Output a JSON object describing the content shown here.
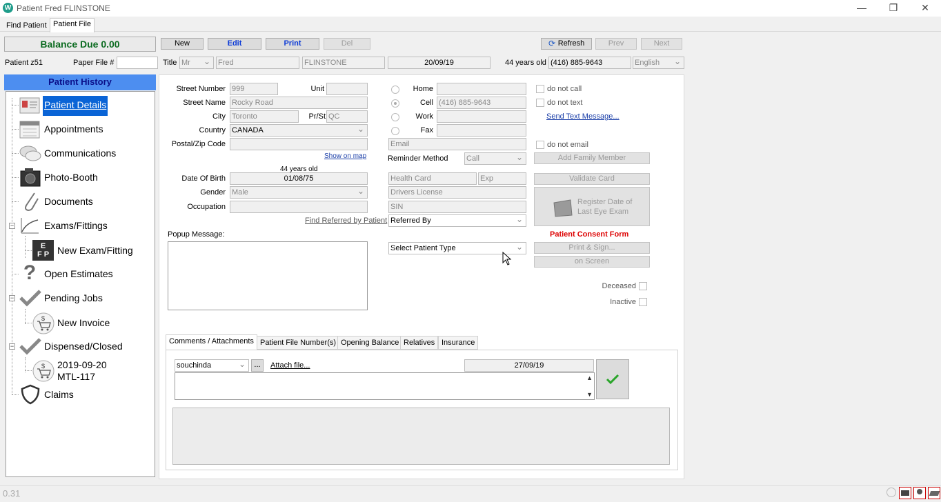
{
  "window": {
    "title": "Patient Fred FLINSTONE",
    "app_icon": "W",
    "min": "—",
    "max": "❐",
    "close": "✕"
  },
  "tabs": [
    "Find Patient",
    "Patient File"
  ],
  "toolbar": {
    "balance": "Balance Due 0.00",
    "new": "New",
    "edit": "Edit",
    "print": "Print",
    "del": "Del",
    "refresh": "Refresh",
    "prev": "Prev",
    "next": "Next"
  },
  "patient": {
    "id_label": "Patient z51",
    "paper_file_label": "Paper File #",
    "paper_file_value": "",
    "title_label": "Title",
    "title_value": "Mr",
    "first_name": "Fred",
    "last_name": "FLINSTONE",
    "date": "20/09/19",
    "age": "44 years old",
    "phone": "(416) 885-9643",
    "language": "English"
  },
  "sidebar": {
    "header": "Patient History",
    "items": [
      {
        "label": "Patient Details"
      },
      {
        "label": "Appointments"
      },
      {
        "label": "Communications"
      },
      {
        "label": "Photo-Booth"
      },
      {
        "label": "Documents"
      },
      {
        "label": "Exams/Fittings"
      },
      {
        "label": "New Exam/Fitting"
      },
      {
        "label": "Open Estimates"
      },
      {
        "label": "Pending Jobs"
      },
      {
        "label": "New Invoice"
      },
      {
        "label": "Dispensed/Closed"
      },
      {
        "label": "2019-09-20"
      },
      {
        "label": "MTL-117"
      },
      {
        "label": "Claims"
      }
    ]
  },
  "address": {
    "street_number_label": "Street Number",
    "street_number": "999",
    "unit_label": "Unit",
    "unit": "",
    "street_name_label": "Street Name",
    "street_name": "Rocky Road",
    "city_label": "City",
    "city": "Toronto",
    "prst_label": "Pr/St",
    "prst": "QC",
    "country_label": "Country",
    "country": "CANADA",
    "postal_label": "Postal/Zip Code",
    "postal": "",
    "show_on_map": "Show on map"
  },
  "personal": {
    "age_note": "44 years old",
    "dob_label": "Date Of Birth",
    "dob": "01/08/75",
    "gender_label": "Gender",
    "gender": "Male",
    "occupation_label": "Occupation",
    "occupation": "",
    "find_referred": "Find Referred by Patient",
    "popup_label": "Popup Message:"
  },
  "contact": {
    "home_label": "Home",
    "home": "",
    "cell_label": "Cell",
    "cell": "(416) 885-9643",
    "work_label": "Work",
    "work": "",
    "fax_label": "Fax",
    "fax": "",
    "email": "Email",
    "reminder_label": "Reminder Method",
    "reminder": "Call",
    "health_card": "Health Card",
    "exp": "Exp",
    "drivers_license": "Drivers License",
    "sin": "SIN",
    "referred_by": "Referred By",
    "patient_type": "Select Patient Type"
  },
  "options": {
    "do_not_call": "do not call",
    "do_not_text": "do not text",
    "send_text": "Send Text Message...",
    "do_not_email": "do not email",
    "add_family": "Add Family Member",
    "validate_card": "Validate Card",
    "register_eye_exam": "Register Date of Last Eye Exam",
    "consent_title": "Patient Consent Form",
    "print_sign": "Print & Sign...",
    "on_screen": "on Screen",
    "deceased": "Deceased",
    "inactive": "Inactive"
  },
  "bottom_tabs": [
    "Comments / Attachments",
    "Patient File Number(s)",
    "Opening Balance",
    "Relatives",
    "Insurance"
  ],
  "comments": {
    "user": "souchinda",
    "ellipsis": "...",
    "attach": "Attach file...",
    "date": "27/09/19"
  },
  "status": {
    "version": "0.31"
  },
  "colors": {
    "accent": "#4d8ef0",
    "balance_text": "#0b6b20",
    "consent": "#dd0000",
    "link": "#1a3ea8"
  }
}
